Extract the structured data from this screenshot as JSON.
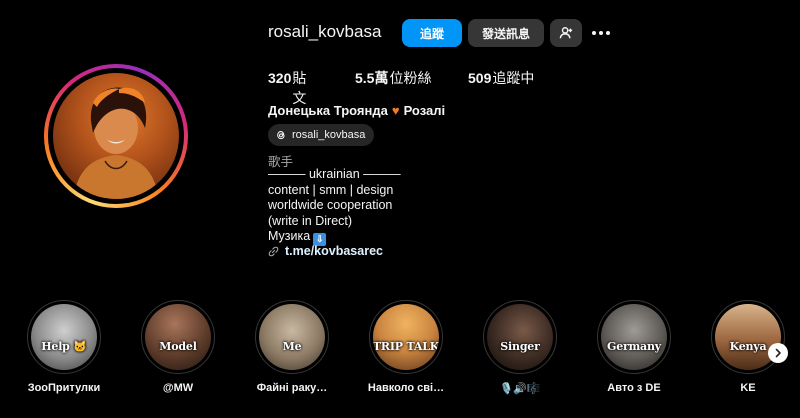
{
  "profile": {
    "username": "rosali_kovbasa",
    "follow_label": "追蹤",
    "message_label": "發送訊息",
    "stats": {
      "posts_count": "320",
      "posts_label": "貼文",
      "followers_count": "5.5萬",
      "followers_label": "位粉絲",
      "following_count": "509",
      "following_label": "追蹤中"
    },
    "full_name": "Донецька Троянда",
    "name_suffix": "Розалі",
    "threads_handle": "rosali_kovbasa",
    "category": "歌手",
    "bio": [
      "——— ukrainian ———",
      "content | smm | design",
      "worldwide cooperation",
      "(write in Direct)",
      "Музика"
    ],
    "link": "t.me/kovbasarec"
  },
  "highlights": [
    {
      "cover_text": "Help 🐱",
      "label": "ЗооПритулки",
      "bg": "#9a9a9a"
    },
    {
      "cover_text": "Model",
      "label": "@MW",
      "bg": "#6a4a36"
    },
    {
      "cover_text": "Me",
      "label": "Файні раку…",
      "bg": "#8c7a64"
    },
    {
      "cover_text": "TRIP TALK",
      "label": "Навколо сві…",
      "bg": "#c98440"
    },
    {
      "cover_text": "Singer",
      "label": "🎙️🔊🎼",
      "bg": "#3a2a22"
    },
    {
      "cover_text": "Germany",
      "label": "Авто з DE",
      "bg": "#5e5a56"
    },
    {
      "cover_text": "Kenya",
      "label": "KE",
      "bg": "#9c6640"
    }
  ],
  "colors": {
    "accent": "#0095f6",
    "button_bg": "#363636",
    "heart": "#f07b2a"
  }
}
